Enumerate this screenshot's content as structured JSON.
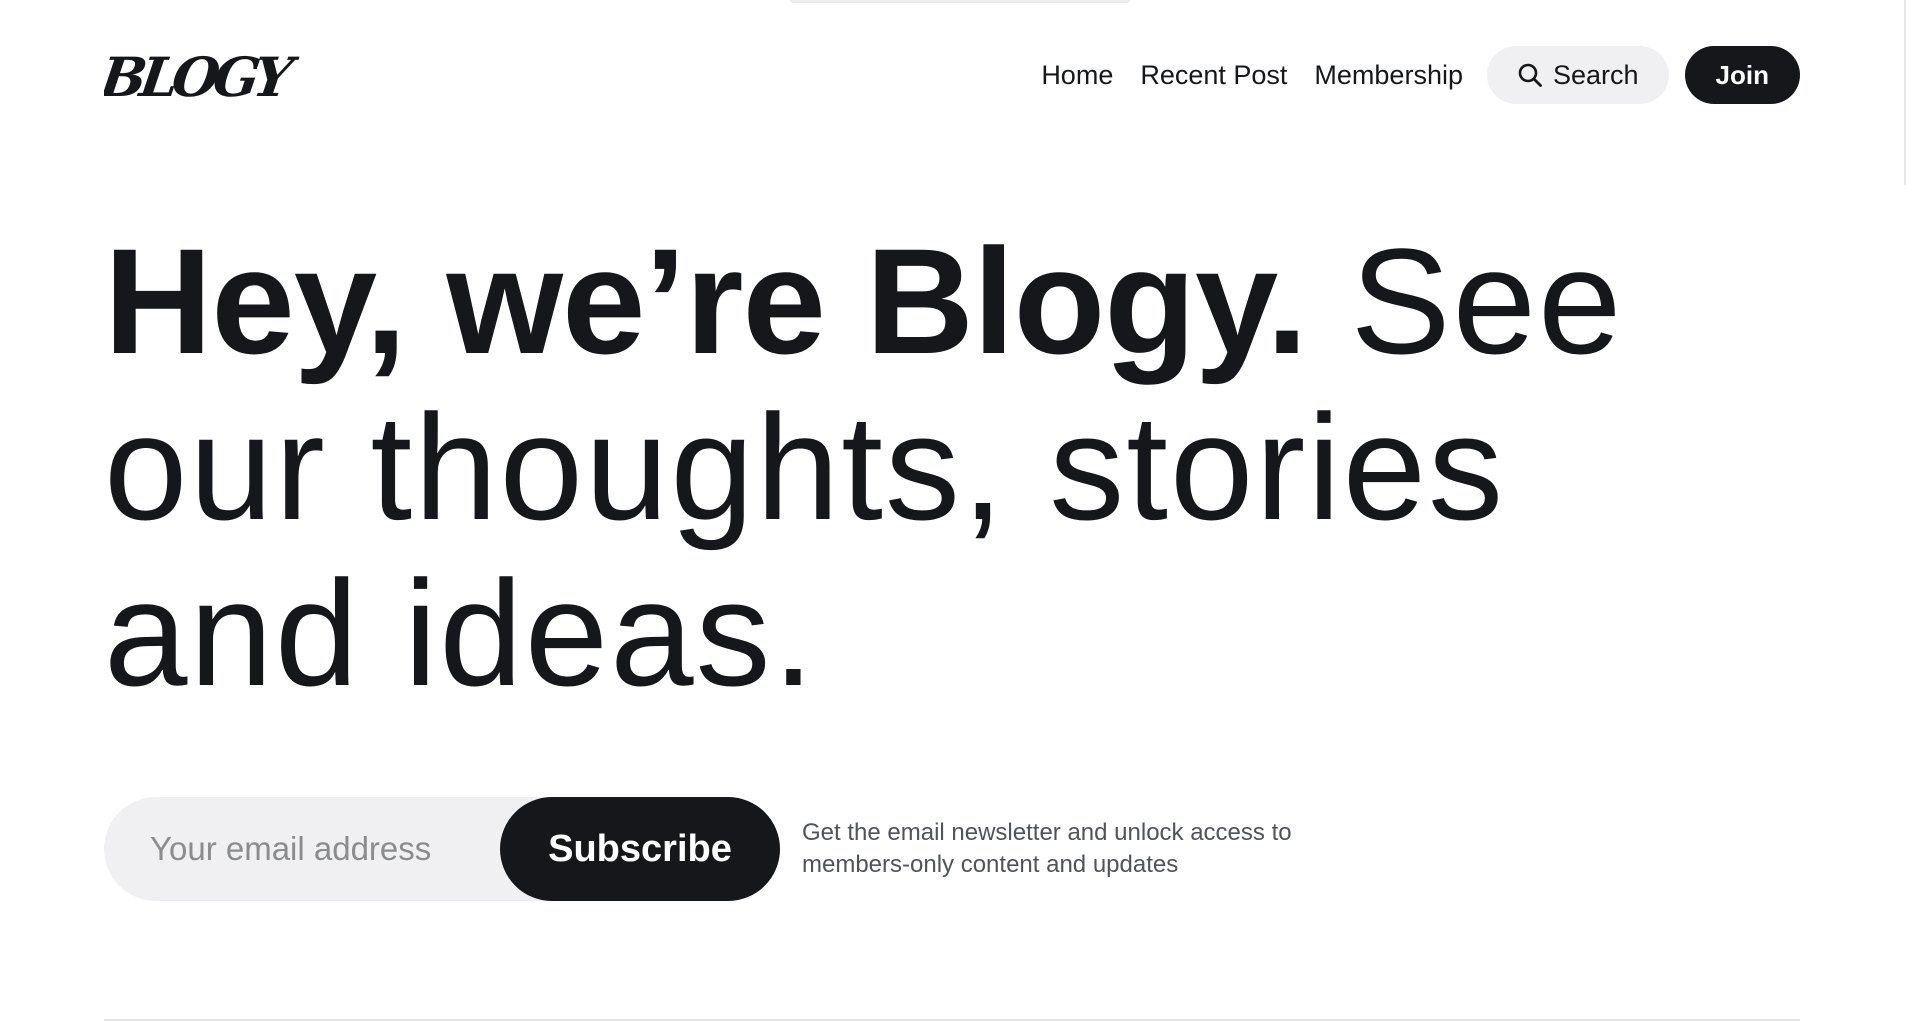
{
  "site": {
    "logo_text": "BLOGY"
  },
  "nav": {
    "links": [
      "Home",
      "Recent Post",
      "Membership"
    ],
    "search_label": "Search",
    "join_label": "Join"
  },
  "hero": {
    "bold_text": "Hey, we’re Blogy.",
    "light_text": " See our thoughts, stories and ideas."
  },
  "subscribe": {
    "email_placeholder": "Your email address",
    "email_value": "",
    "button_label": "Subscribe",
    "note_line1": "Get the email newsletter and unlock access to",
    "note_line2": "members-only content and updates"
  },
  "icons": {
    "search": "search-icon"
  },
  "colors": {
    "text": "#15171a",
    "button_dark": "#15171a",
    "pill_background": "#f0eff1",
    "muted_text": "#505358"
  }
}
